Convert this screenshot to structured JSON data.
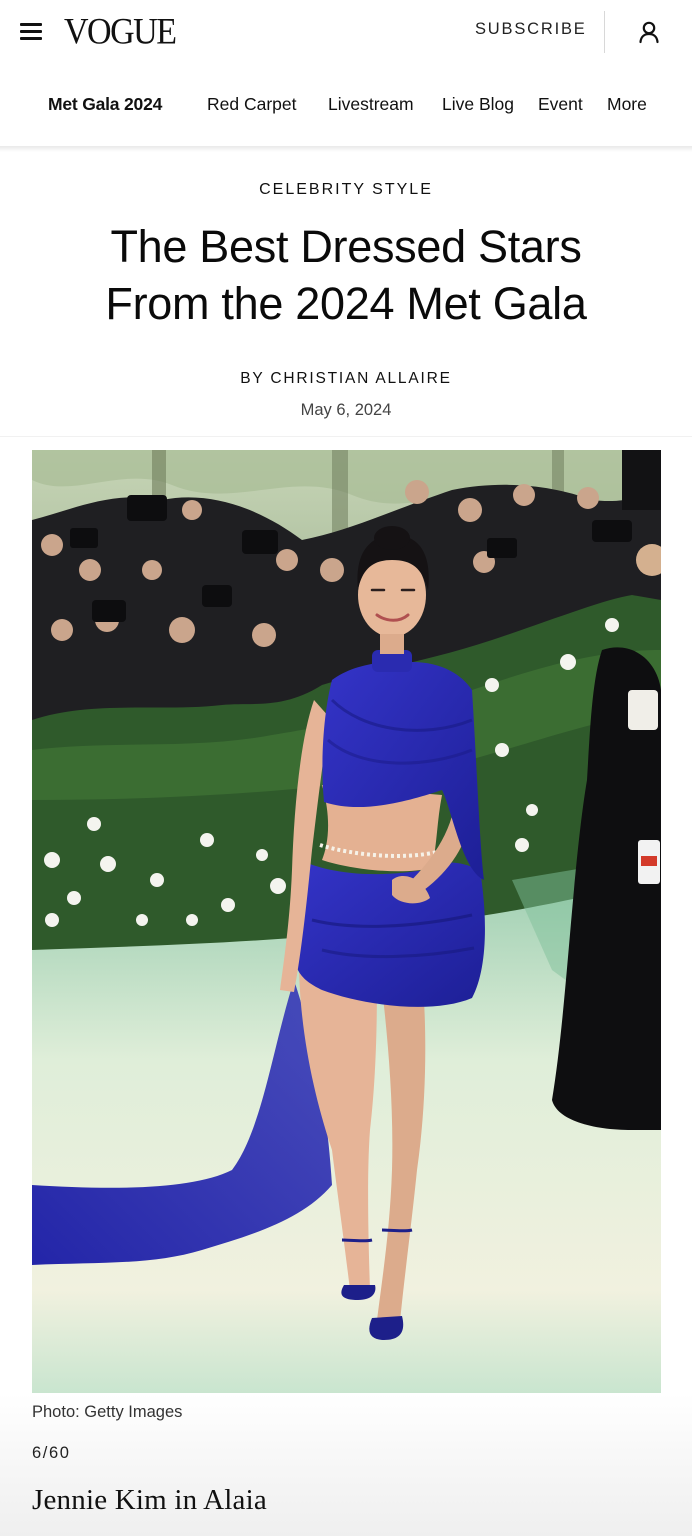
{
  "header": {
    "logo": "VOGUE",
    "subscribe_label": "SUBSCRIBE",
    "icons": {
      "menu": "hamburger-menu-icon",
      "account": "user-account-icon"
    }
  },
  "nav": {
    "active": "Met Gala 2024",
    "items": [
      "Met Gala 2024",
      "Red Carpet",
      "Livestream",
      "Live Blog",
      "Event",
      "More"
    ]
  },
  "article": {
    "category": "CELEBRITY STYLE",
    "headline_line1": "The Best Dressed Stars",
    "headline_line2": "From the 2024 Met Gala",
    "byline_prefix": "BY ",
    "author": "CHRISTIAN ALLAIRE",
    "date": "May 6, 2024"
  },
  "gallery": {
    "photo_credit": "Photo: Getty Images",
    "counter": "6/60",
    "slide_title": "Jennie Kim in Alaia",
    "dress_color": "#2a2bb0"
  },
  "colors": {
    "text": "#111111",
    "divider": "#d8d8d8",
    "dress": "#2a2bb0"
  }
}
